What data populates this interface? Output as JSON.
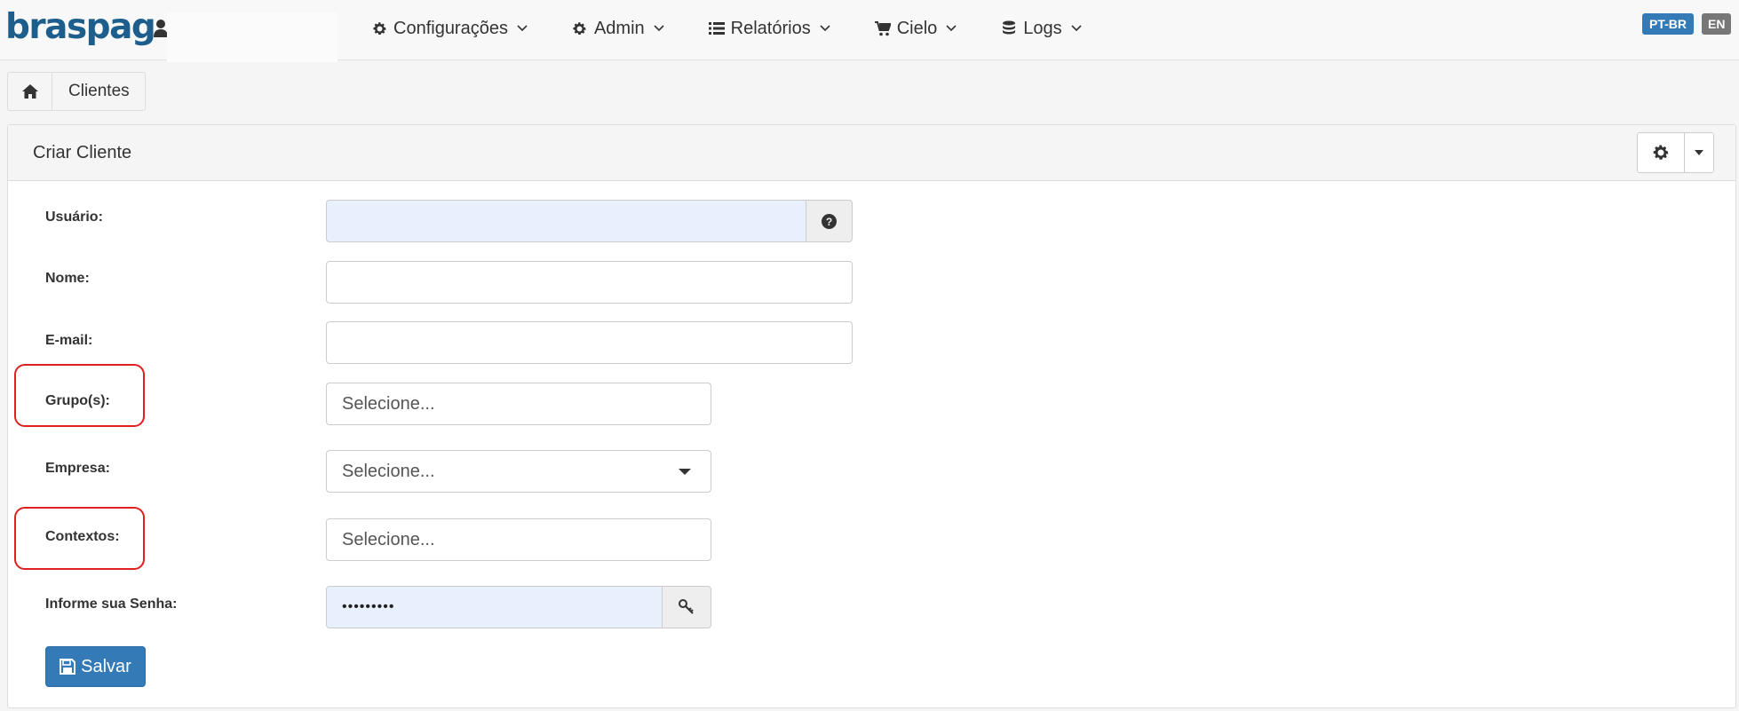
{
  "brand": {
    "logo_text": "braspag"
  },
  "nav": {
    "items": [
      {
        "label": "Configurações",
        "icon": "gear-icon"
      },
      {
        "label": "Admin",
        "icon": "gear-icon"
      },
      {
        "label": "Relatórios",
        "icon": "list-icon"
      },
      {
        "label": "Cielo",
        "icon": "cart-icon"
      },
      {
        "label": "Logs",
        "icon": "database-icon"
      }
    ],
    "languages": [
      "PT-BR",
      "EN"
    ]
  },
  "breadcrumb": {
    "current": "Clientes"
  },
  "panel": {
    "title": "Criar Cliente"
  },
  "form": {
    "usuario_label": "Usuário:",
    "nome_label": "Nome:",
    "email_label": "E-mail:",
    "grupos_label": "Grupo(s):",
    "grupos_placeholder": "Selecione...",
    "empresa_label": "Empresa:",
    "empresa_value": "Selecione...",
    "contextos_label": "Contextos:",
    "contextos_placeholder": "Selecione...",
    "senha_label": "Informe sua Senha:",
    "senha_value": "•••••••••",
    "save_label": "Salvar"
  },
  "colors": {
    "primary": "#337ab7",
    "brand": "#1d5e8c",
    "highlight": "#e02020",
    "autofill": "#e8f0fe"
  }
}
